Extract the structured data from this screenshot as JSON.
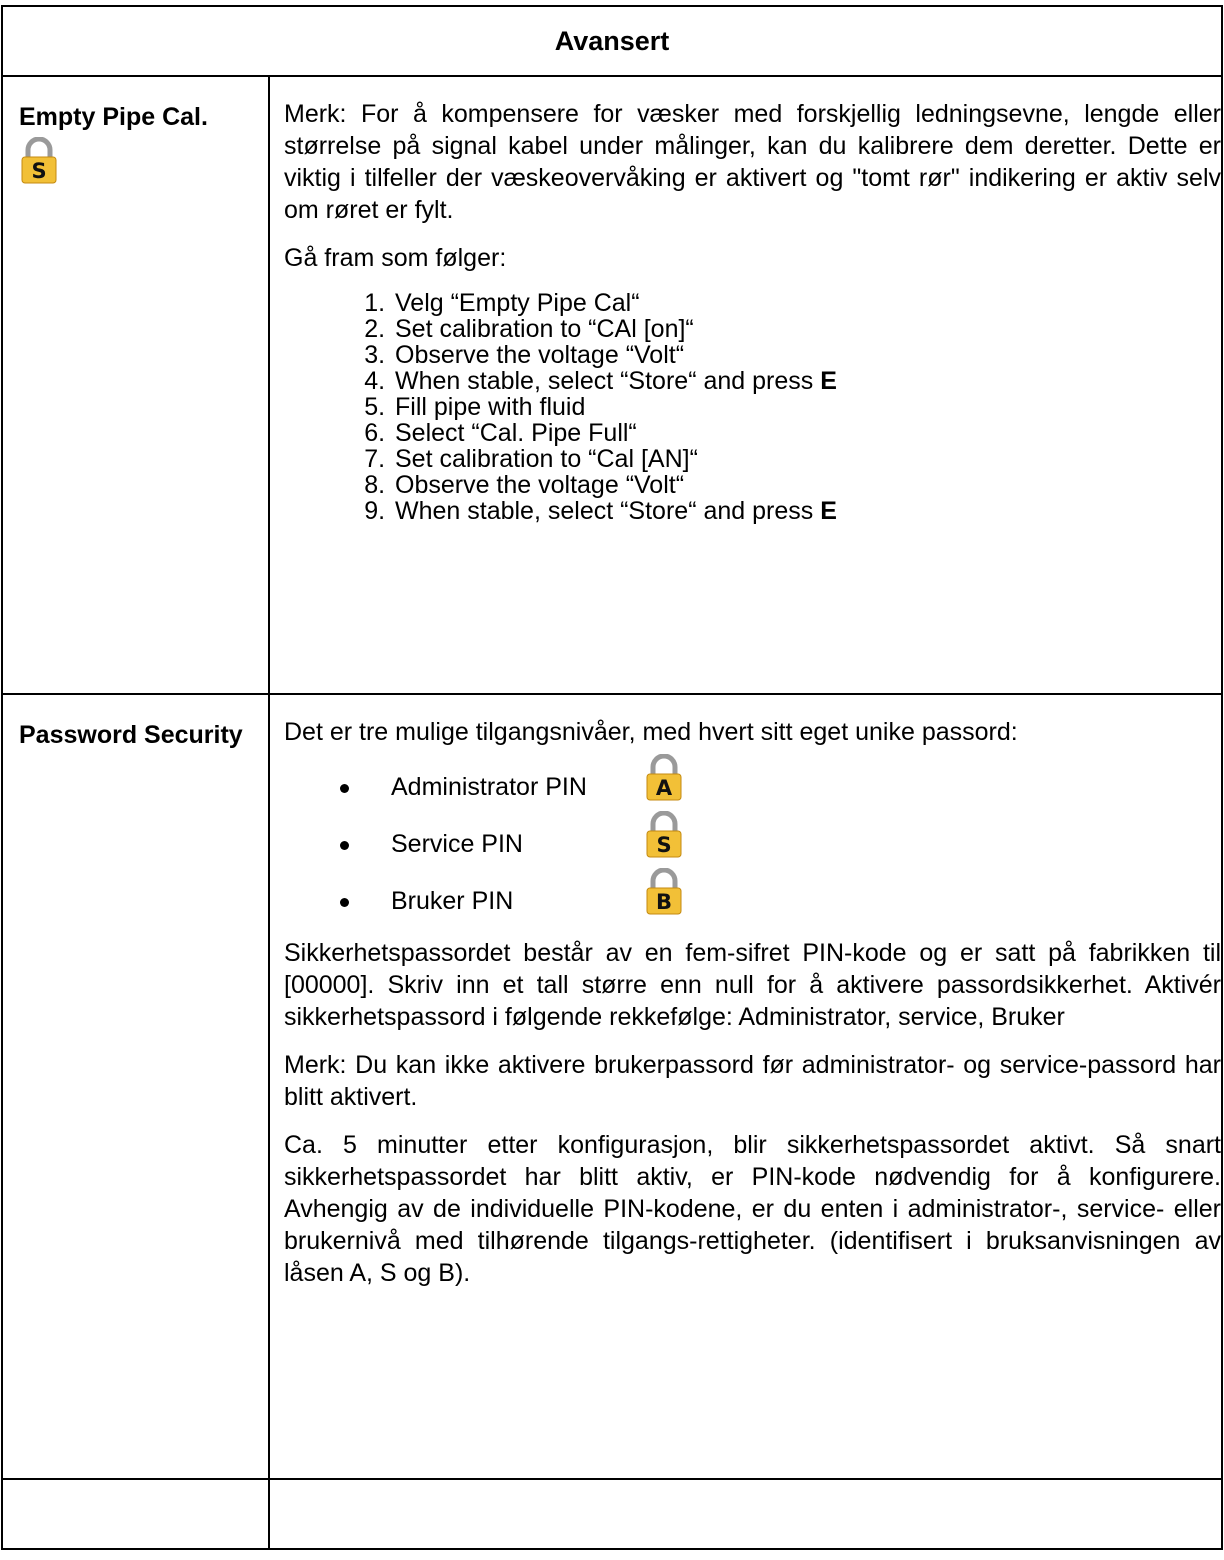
{
  "table": {
    "header": "Avansert",
    "empty_pipe": {
      "name": "Empty Pipe Cal.",
      "lock_letter": "S",
      "intro": "Merk: For å kompensere for væsker med forskjellig ledningsevne, lengde eller størrelse på signal kabel under målinger, kan du kalibrere dem deretter. Dette er viktig i tilfeller der væskeovervåking er aktivert og \"tomt rør\" indikering er aktiv selv om røret er fylt.",
      "proceed": "Gå fram som følger:",
      "steps": [
        "Velg “Empty Pipe Cal“",
        "Set calibration to “CAl [on]“",
        "Observe the voltage “Volt“",
        {
          "text": "When stable, select “Store“ and press ",
          "bold": "E"
        },
        "Fill pipe with fluid",
        "Select “Cal. Pipe Full“",
        "Set calibration to “Cal [AN]“",
        "Observe the voltage “Volt“",
        {
          "text": "When stable, select “Store“ and press ",
          "bold": "E"
        }
      ]
    },
    "password": {
      "name": "Password Security",
      "intro": "Det er tre mulige tilgangsnivåer, med hvert sitt eget unike passord:",
      "levels": [
        {
          "label": "Administrator PIN",
          "lock_letter": "A"
        },
        {
          "label": "Service PIN",
          "lock_letter": "S"
        },
        {
          "label": "Bruker PIN",
          "lock_letter": "B"
        }
      ],
      "para1": "Sikkerhetspassordet består av en fem-sifret PIN-kode og er satt på fabrikken til [00000]. Skriv inn et tall større enn null for å aktivere passordsikkerhet. Aktivér sikkerhetspassord i følgende rekkefølge: Administrator, service, Bruker",
      "para2": "Merk: Du kan ikke aktivere brukerpassord før administrator- og service-passord har blitt aktivert.",
      "para3": "Ca. 5 minutter etter konfigurasjon, blir sikkerhetspassordet aktivt. Så snart sikkerhetspassordet har blitt aktiv, er PIN-kode nødvendig for å konfigurere. Avhengig av de individuelle PIN-kodene, er du enten i administrator-, service- eller brukernivå med tilhørende tilgangs-rettigheter. (identifisert i bruksanvisningen av låsen A, S og B)."
    }
  },
  "colors": {
    "lock_body": "#f2c037",
    "lock_shackle": "#9a9a9a",
    "border": "#000000"
  }
}
